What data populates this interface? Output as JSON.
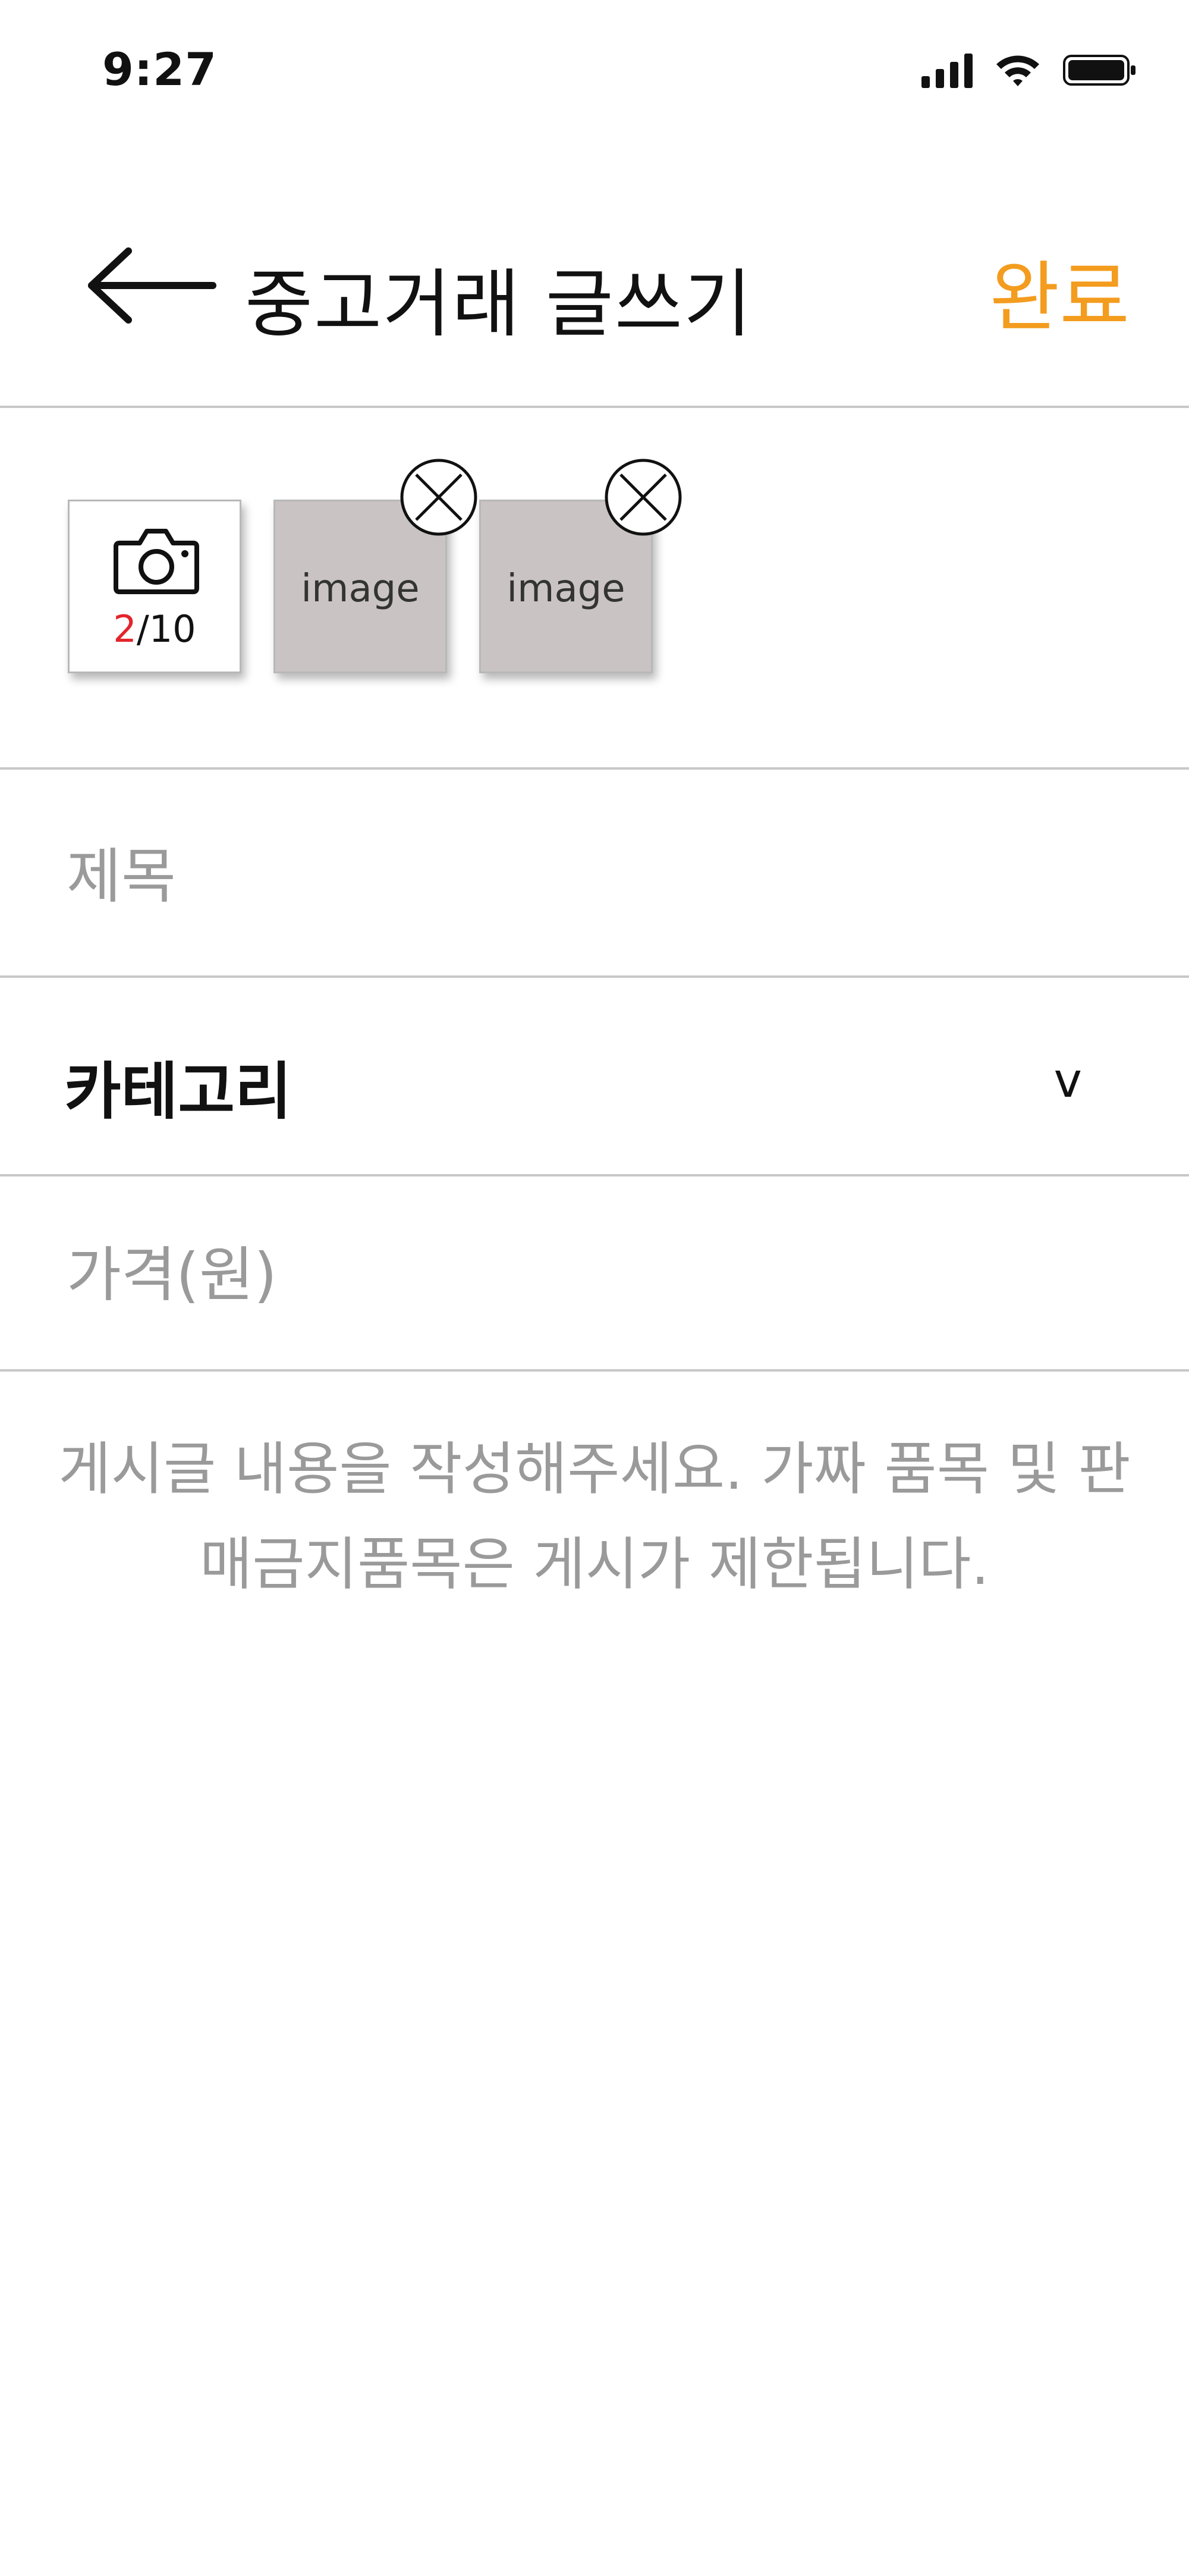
{
  "status_bar": {
    "time": "9:27"
  },
  "header": {
    "title": "중고거래 글쓰기",
    "done_label": "완료"
  },
  "photos": {
    "count_current": "2",
    "count_total": "/10",
    "images": [
      {
        "label": "image"
      },
      {
        "label": "image"
      }
    ]
  },
  "form": {
    "title_placeholder": "제목",
    "title_value": "",
    "category_label": "카테고리",
    "category_chevron": "v",
    "price_placeholder": "가격(원)",
    "price_value": "",
    "content_placeholder": "게시글 내용을 작성해주세요. 가짜 품목 및 판매금지품목은 게시가 제한됩니다.",
    "content_value": ""
  },
  "colors": {
    "accent": "#f39c1e",
    "count_highlight": "#e3242b",
    "image_placeholder": "#cac3c3"
  }
}
